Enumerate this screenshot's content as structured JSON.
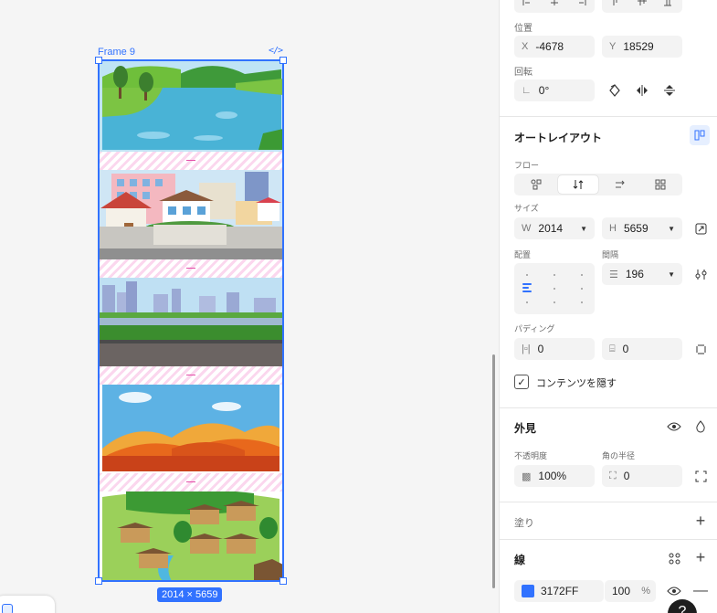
{
  "canvas": {
    "frame_name": "Frame 9",
    "code_icon": "</>",
    "size_badge": "2014 × 5659",
    "accent": "#3172FF",
    "gap_color": "#E34EA8"
  },
  "panel": {
    "position": {
      "label": "位置",
      "x_prefix": "X",
      "x_value": "-4678",
      "y_prefix": "Y",
      "y_value": "18529"
    },
    "rotation": {
      "label": "回転",
      "prefix": "∟",
      "value": "0°"
    },
    "auto_layout": {
      "title": "オートレイアウト",
      "flow_label": "フロー",
      "size_label": "サイズ",
      "w_prefix": "W",
      "w_value": "2014",
      "h_prefix": "H",
      "h_value": "5659",
      "align_label": "配置",
      "gap_label": "間隔",
      "gap_value": "196",
      "padding_label": "パディング",
      "padding_h_value": "0",
      "padding_v_value": "0",
      "clip_label": "コンテンツを隠す",
      "clip_checked": true
    },
    "appearance": {
      "title": "外見",
      "opacity_label": "不透明度",
      "opacity_value": "100%",
      "radius_label": "角の半径",
      "radius_value": "0"
    },
    "fill": {
      "title": "塗り"
    },
    "stroke": {
      "title": "線",
      "color_hex": "3172FF",
      "opacity": "100",
      "unit": "%"
    },
    "help_label": "?"
  }
}
